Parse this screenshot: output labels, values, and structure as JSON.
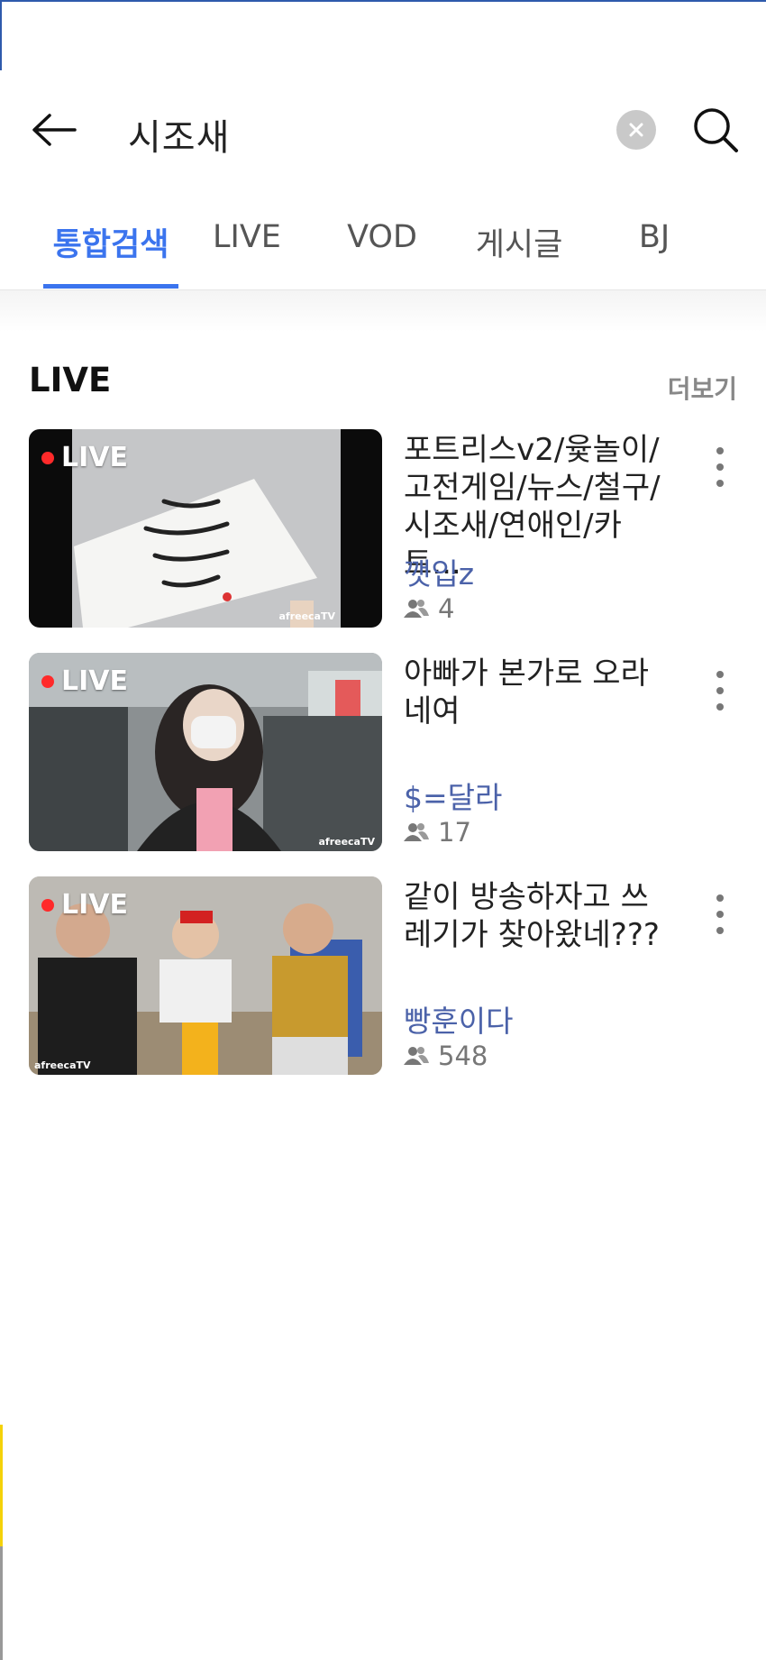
{
  "search": {
    "query": "시조새"
  },
  "tabs": [
    {
      "label": "통합검색",
      "active": true
    },
    {
      "label": "LIVE",
      "active": false
    },
    {
      "label": "VOD",
      "active": false
    },
    {
      "label": "게시글",
      "active": false
    },
    {
      "label": "BJ",
      "active": false
    }
  ],
  "section": {
    "title": "LIVE",
    "more_label": "더보기"
  },
  "live_badge": "LIVE",
  "watermark": "afreecaTV",
  "items": [
    {
      "title": "포트리스v2/윷놀이/고전게임/뉴스/철구/시조새/연애인/카트...",
      "bj": "깻입z",
      "viewers": "4"
    },
    {
      "title": "아빠가 본가로 오라네여",
      "bj": "$=달라",
      "viewers": "17"
    },
    {
      "title": "같이 방송하자고 쓰레기가 찾아왔네???",
      "bj": "빵훈이다",
      "viewers": "548"
    }
  ],
  "colors": {
    "accent": "#3b74ee",
    "bj_name": "#4b62a9",
    "live_dot": "#ff2a2a"
  }
}
